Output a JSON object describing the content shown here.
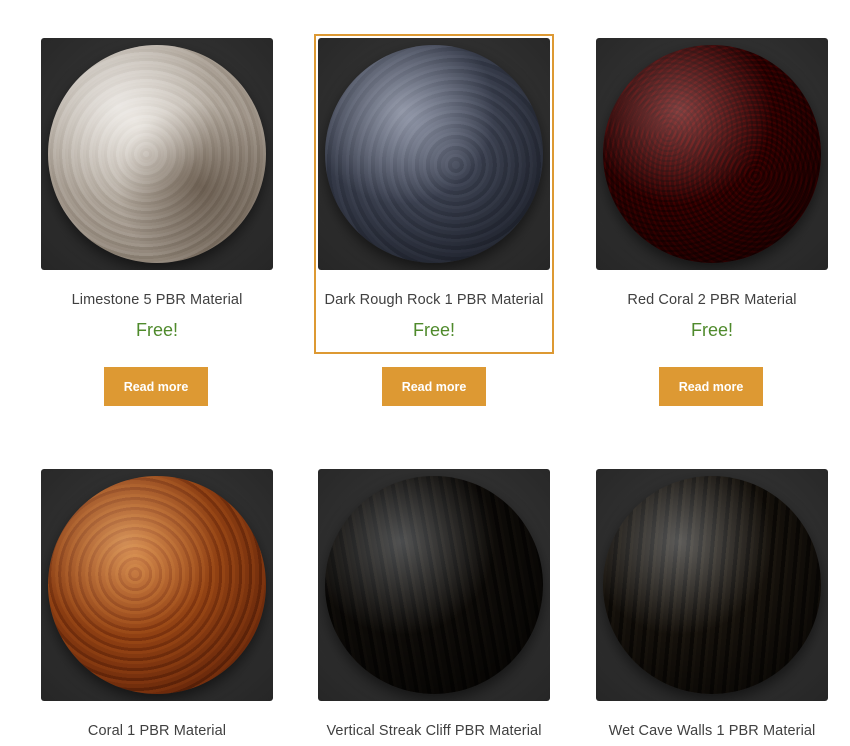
{
  "products": [
    {
      "title": "Limestone 5 PBR Material",
      "price": "Free!",
      "button": "Read more",
      "image": "Limestone 5 material sphere"
    },
    {
      "title": "Dark Rough Rock 1 PBR Material",
      "price": "Free!",
      "button": "Read more",
      "image": "Dark Rough Rock 1 material sphere"
    },
    {
      "title": "Red Coral 2 PBR Material",
      "price": "Free!",
      "button": "Read more",
      "image": "Red Coral 2 material sphere"
    },
    {
      "title": "Coral 1 PBR Material",
      "image": "Coral 1 material sphere"
    },
    {
      "title": "Vertical Streak Cliff PBR Material",
      "image": "Vertical Streak Cliff material sphere"
    },
    {
      "title": "Wet Cave Walls 1 PBR Material",
      "image": "Wet Cave Walls 1 material sphere"
    }
  ],
  "colors": {
    "accent": "#dd9933",
    "price": "#4f8a2c",
    "text": "#404040"
  }
}
